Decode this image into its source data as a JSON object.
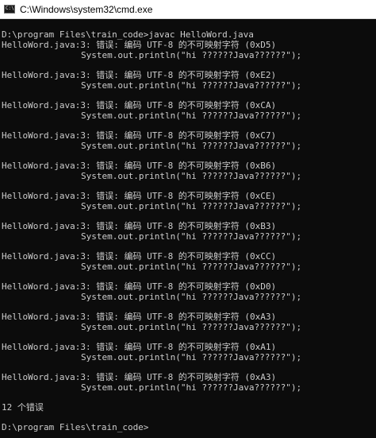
{
  "window": {
    "title": "C:\\Windows\\system32\\cmd.exe",
    "icon": "cmd-console-icon",
    "icon_glyph": "C:\\"
  },
  "console": {
    "command_line": "D:\\program Files\\train_code>javac HelloWord.java",
    "errors": [
      {
        "message": "HelloWord.java:3: 错误: 编码 UTF-8 的不可映射字符 (0xD5)",
        "source": "System.out.println(\"hi ??????Java??????\");"
      },
      {
        "message": "HelloWord.java:3: 错误: 编码 UTF-8 的不可映射字符 (0xE2)",
        "source": "System.out.println(\"hi ??????Java??????\");"
      },
      {
        "message": "HelloWord.java:3: 错误: 编码 UTF-8 的不可映射字符 (0xCA)",
        "source": "System.out.println(\"hi ??????Java??????\");"
      },
      {
        "message": "HelloWord.java:3: 错误: 编码 UTF-8 的不可映射字符 (0xC7)",
        "source": "System.out.println(\"hi ??????Java??????\");"
      },
      {
        "message": "HelloWord.java:3: 错误: 编码 UTF-8 的不可映射字符 (0xB6)",
        "source": "System.out.println(\"hi ??????Java??????\");"
      },
      {
        "message": "HelloWord.java:3: 错误: 编码 UTF-8 的不可映射字符 (0xCE)",
        "source": "System.out.println(\"hi ??????Java??????\");"
      },
      {
        "message": "HelloWord.java:3: 错误: 编码 UTF-8 的不可映射字符 (0xB3)",
        "source": "System.out.println(\"hi ??????Java??????\");"
      },
      {
        "message": "HelloWord.java:3: 错误: 编码 UTF-8 的不可映射字符 (0xCC)",
        "source": "System.out.println(\"hi ??????Java??????\");"
      },
      {
        "message": "HelloWord.java:3: 错误: 编码 UTF-8 的不可映射字符 (0xD0)",
        "source": "System.out.println(\"hi ??????Java??????\");"
      },
      {
        "message": "HelloWord.java:3: 错误: 编码 UTF-8 的不可映射字符 (0xA3)",
        "source": "System.out.println(\"hi ??????Java??????\");"
      },
      {
        "message": "HelloWord.java:3: 错误: 编码 UTF-8 的不可映射字符 (0xA1)",
        "source": "System.out.println(\"hi ??????Java??????\");"
      },
      {
        "message": "HelloWord.java:3: 错误: 编码 UTF-8 的不可映射字符 (0xA3)",
        "source": "System.out.println(\"hi ??????Java??????\");"
      }
    ],
    "summary": "12 个错误",
    "prompt": "D:\\program Files\\train_code>"
  },
  "colors": {
    "background": "#0c0c0c",
    "text": "#cccccc",
    "titlebar": "#ffffff"
  }
}
